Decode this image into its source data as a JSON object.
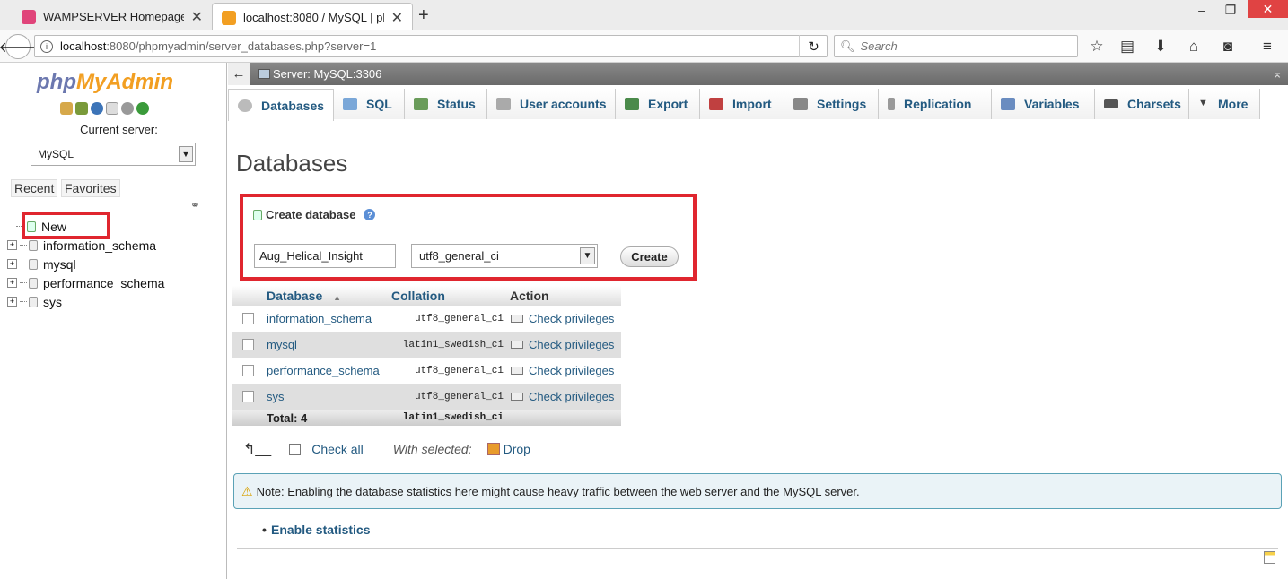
{
  "browser": {
    "tabs": [
      {
        "title": "WAMPSERVER Homepage",
        "active": false,
        "favicon_color": "#e0447a"
      },
      {
        "title": "localhost:8080 / MySQL | ph",
        "active": true,
        "favicon_color": "#f29f22"
      }
    ],
    "new_tab_label": "+",
    "url_host": "localhost",
    "url_rest": ":8080/phpmyadmin/server_databases.php?server=1",
    "search_placeholder": "Search",
    "window_buttons": {
      "minimize": "–",
      "maximize": "❐",
      "close": "✕"
    }
  },
  "sidebar": {
    "logo_part1": "php",
    "logo_part2": "MyAdmin",
    "current_server_label": "Current server:",
    "server_value": "MySQL",
    "recent_label": "Recent",
    "favorites_label": "Favorites",
    "tree": [
      {
        "label": "New",
        "type": "new"
      },
      {
        "label": "information_schema",
        "type": "db"
      },
      {
        "label": "mysql",
        "type": "db"
      },
      {
        "label": "performance_schema",
        "type": "db"
      },
      {
        "label": "sys",
        "type": "db"
      }
    ]
  },
  "server_bar": {
    "label": "Server: MySQL:3306"
  },
  "menu": [
    {
      "label": "Databases",
      "active": true,
      "icon_color": "#bbb"
    },
    {
      "label": "SQL",
      "active": false,
      "icon_color": "#7aa7d8"
    },
    {
      "label": "Status",
      "active": false,
      "icon_color": "#6a9c5a"
    },
    {
      "label": "User accounts",
      "active": false,
      "icon_color": "#aaa"
    },
    {
      "label": "Export",
      "active": false,
      "icon_color": "#4a8a4a"
    },
    {
      "label": "Import",
      "active": false,
      "icon_color": "#c04040"
    },
    {
      "label": "Settings",
      "active": false,
      "icon_color": "#888"
    },
    {
      "label": "Replication",
      "active": false,
      "icon_color": "#999"
    },
    {
      "label": "Variables",
      "active": false,
      "icon_color": "#6a8cc0"
    },
    {
      "label": "Charsets",
      "active": false,
      "icon_color": "#555"
    },
    {
      "label": "More",
      "active": false,
      "icon_color": "#555"
    }
  ],
  "page_title": "Databases",
  "create_db": {
    "heading": "Create database",
    "name_value": "Aug_Helical_Insight",
    "collation_value": "utf8_general_ci",
    "button_label": "Create"
  },
  "table": {
    "headers": {
      "database": "Database",
      "collation": "Collation",
      "action": "Action"
    },
    "rows": [
      {
        "name": "information_schema",
        "collation": "utf8_general_ci",
        "action": "Check privileges"
      },
      {
        "name": "mysql",
        "collation": "latin1_swedish_ci",
        "action": "Check privileges"
      },
      {
        "name": "performance_schema",
        "collation": "utf8_general_ci",
        "action": "Check privileges"
      },
      {
        "name": "sys",
        "collation": "utf8_general_ci",
        "action": "Check privileges"
      }
    ],
    "total_label": "Total: 4",
    "total_collation": "latin1_swedish_ci"
  },
  "bulk": {
    "check_all": "Check all",
    "with_selected": "With selected:",
    "drop": "Drop"
  },
  "notice": "Note: Enabling the database statistics here might cause heavy traffic between the web server and the MySQL server.",
  "enable_stats": "Enable statistics",
  "colors": {
    "accent": "#235a81",
    "highlight_red": "#e0262f",
    "notice_border": "#5aa2b6"
  }
}
